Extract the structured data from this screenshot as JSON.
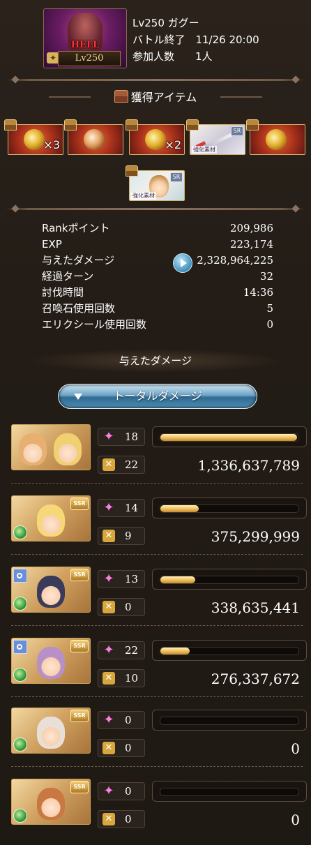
{
  "header": {
    "boss_difficulty": "HELL",
    "boss_level_badge": "Lv250",
    "boss_name": "Lv250 ガグー",
    "battle_end": "バトル終了　11/26 20:00",
    "participants": "参加人数　　1人"
  },
  "loot": {
    "title": "獲得アイテム",
    "items": [
      {
        "name": "gold-medal",
        "count": "×3",
        "tag": ""
      },
      {
        "name": "orb",
        "count": "",
        "tag": ""
      },
      {
        "name": "gold-emblem",
        "count": "×2",
        "tag": ""
      },
      {
        "name": "weapon",
        "count": "",
        "tag": "強化素材",
        "rarity": "SR"
      },
      {
        "name": "gold-medal-2",
        "count": "",
        "tag": ""
      },
      {
        "name": "character",
        "count": "",
        "tag": "強化素材",
        "rarity": "SR"
      }
    ]
  },
  "stats": [
    {
      "label": "Rankポイント",
      "value": "209,986"
    },
    {
      "label": "EXP",
      "value": "223,174"
    },
    {
      "label": "与えたダメージ",
      "value": "2,328,964,225"
    },
    {
      "label": "経過ターン",
      "value": "32"
    },
    {
      "label": "討伐時間",
      "value": "14:36"
    },
    {
      "label": "召喚石使用回数",
      "value": "5"
    },
    {
      "label": "エリクシール使用回数",
      "value": "0"
    }
  ],
  "damage_section": {
    "title": "与えたダメージ",
    "toggle_label": "トータルダメージ"
  },
  "party": [
    {
      "hits": "18",
      "ougi": "22",
      "damage": "1,336,637,789",
      "fill": 0.99,
      "rarity": "",
      "element": "",
      "ring": false
    },
    {
      "hits": "14",
      "ougi": "9",
      "damage": "375,299,999",
      "fill": 0.28,
      "rarity": "SSR",
      "element": "wind",
      "ring": false
    },
    {
      "hits": "13",
      "ougi": "0",
      "damage": "338,635,441",
      "fill": 0.25,
      "rarity": "SSR",
      "element": "wind",
      "ring": true
    },
    {
      "hits": "22",
      "ougi": "10",
      "damage": "276,337,672",
      "fill": 0.21,
      "rarity": "SSR",
      "element": "wind",
      "ring": true
    },
    {
      "hits": "0",
      "ougi": "0",
      "damage": "0",
      "fill": 0,
      "rarity": "SSR",
      "element": "wind",
      "ring": false
    },
    {
      "hits": "0",
      "ougi": "0",
      "damage": "0",
      "fill": 0,
      "rarity": "SSR",
      "element": "wind",
      "ring": false
    }
  ],
  "icons": {
    "hit": "sparkle-icon",
    "ougi": "ougi-icon",
    "play": "play-icon"
  },
  "colors": {
    "bar_fill": "#f0c264",
    "hit_icon": "#ff7ee0",
    "button_blue": "#4f8db3"
  }
}
